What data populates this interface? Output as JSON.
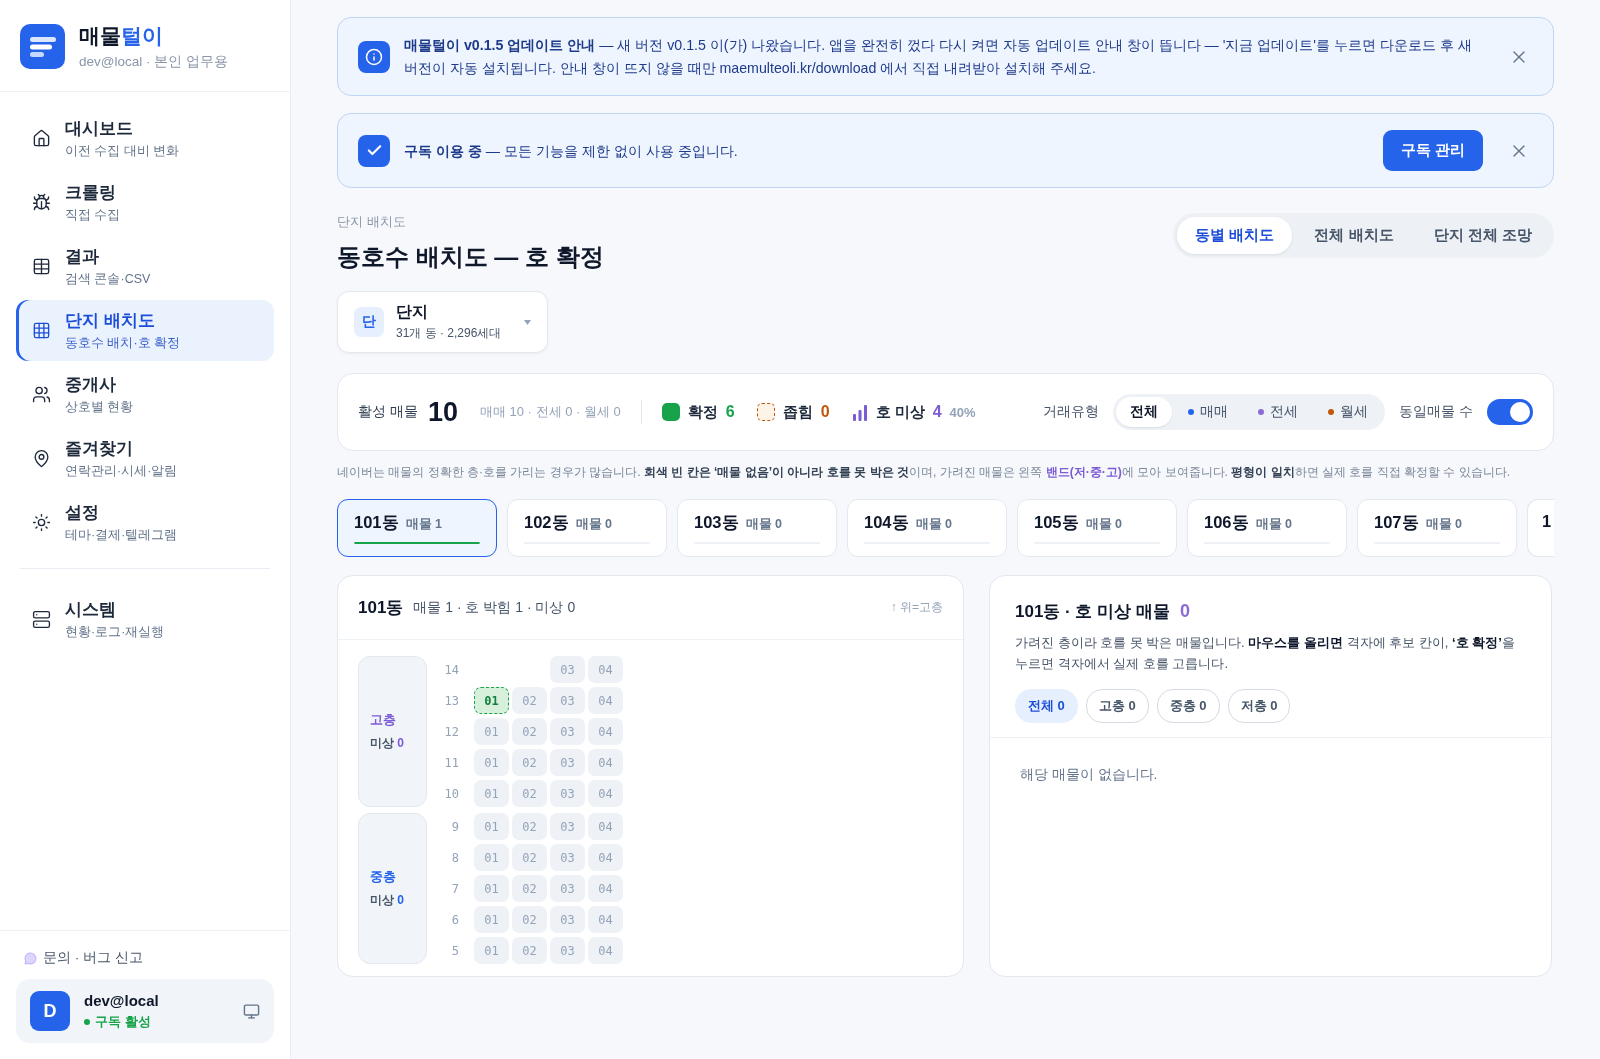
{
  "sidebar": {
    "brand": {
      "title": [
        {
          "text": "매물",
          "accent": false
        },
        {
          "text": "털이",
          "accent": true
        }
      ],
      "subtitle": "dev@local · 본인 업무용"
    },
    "nav_groups": [
      [
        {
          "label": "대시보드",
          "sub": "이전 수집 대비 변화",
          "selected": false
        },
        {
          "label": "크롤링",
          "sub": "직접 수집",
          "selected": false
        },
        {
          "label": "결과",
          "sub": "검색 콘솔·CSV",
          "selected": false
        },
        {
          "label": "단지 배치도",
          "sub": "동호수 배치·호 확정",
          "selected": true
        },
        {
          "label": "중개사",
          "sub": "상호별 현황",
          "selected": false
        },
        {
          "label": "즐겨찾기",
          "sub": "연락관리·시세·알림",
          "selected": false
        },
        {
          "label": "설정",
          "sub": "테마·결제·텔레그램",
          "selected": false
        }
      ],
      [
        {
          "label": "시스템",
          "sub": "현황·로그·재실행",
          "selected": false
        }
      ]
    ],
    "feedback": "문의 · 버그 신고",
    "user": {
      "avatar": "D",
      "name": "dev@local",
      "status": "구독 활성"
    }
  },
  "banners": [
    {
      "kind": "info",
      "text": "**매물털이 v0.1.5 업데이트 안내** — 새 버전 v0.1.5 이(가) 나왔습니다. 앱을 완전히 껐다 다시 켜면 자동 업데이트 안내 창이 뜹니다 — '지금 업데이트'를 누르면 다운로드 후 새 버전이 자동 설치됩니다. 안내 창이 뜨지 않을 때만 maemulteoli.kr/download 에서 직접 내려받아 설치해 주세요."
    },
    {
      "kind": "success",
      "text": "**구독 이용 중** — 모든 기능을 제한 없이 사용 중입니다.",
      "button": "구독 관리"
    }
  ],
  "page": {
    "breadcrumb": "단지 배치도",
    "title": "동호수 배치도 — 호 확정",
    "view_tabs": [
      {
        "label": "동별 배치도",
        "selected": true
      },
      {
        "label": "전체 배치도",
        "selected": false
      },
      {
        "label": "단지 전체 조망",
        "selected": false
      }
    ],
    "complex": {
      "badge": "단",
      "name": "단지",
      "meta": "31개 동 · 2,296세대"
    }
  },
  "stats": {
    "active_label": "활성 매물",
    "active_count": "10",
    "breakdown": "매매 10 · 전세 0 · 월세 0",
    "legend": [
      {
        "kind": "confirmed",
        "label": "확정",
        "count": "6"
      },
      {
        "kind": "narrowed",
        "label": "좁힘",
        "count": "0"
      },
      {
        "kind": "unplaced",
        "label": "호 미상",
        "count": "4",
        "percent": "40%"
      }
    ],
    "trade_label": "거래유형",
    "trade_types": [
      {
        "label": "전체",
        "selected": true
      },
      {
        "label": "매매",
        "selected": false,
        "color": "#2563eb"
      },
      {
        "label": "전세",
        "selected": false,
        "color": "#8b6ad8"
      },
      {
        "label": "월세",
        "selected": false,
        "color": "#c2570c"
      }
    ],
    "same_count": {
      "label": "동일매물 수",
      "on": true
    }
  },
  "notice": "네이버는 매물의 정확한 층·호를 가리는 경우가 많습니다. **회색 빈 칸은 ‘매물 없음’이 아니라 호를 못 박은 것**이며, 가려진 매물은 왼쪽 **밴드(저·중·고)**에 모아 보여줍니다. **평형이 일치**하면 실제 호를 직접 확정할 수 있습니다.",
  "buildings": [
    {
      "name": "101동",
      "count": "매물 1",
      "selected": true,
      "level": 1
    },
    {
      "name": "102동",
      "count": "매물 0",
      "selected": false,
      "level": 0
    },
    {
      "name": "103동",
      "count": "매물 0",
      "selected": false,
      "level": 0
    },
    {
      "name": "104동",
      "count": "매물 0",
      "selected": false,
      "level": 0
    },
    {
      "name": "105동",
      "count": "매물 0",
      "selected": false,
      "level": 0
    },
    {
      "name": "106동",
      "count": "매물 0",
      "selected": false,
      "level": 0
    },
    {
      "name": "107동",
      "count": "매물 0",
      "selected": false,
      "level": 0
    },
    {
      "name": "1",
      "selected": false,
      "kind": "partial"
    }
  ],
  "layout_panel": {
    "title": "101동",
    "summary": "매물 1 · 호 박힘 1 · 미상 0",
    "hint": "↑ 위=고층",
    "bands": [
      {
        "label": "고층",
        "unplaced_label": "미상",
        "count": "0",
        "color": "#7c5cd6",
        "floors": [
          {
            "floor": "14",
            "units": [
              {
                "kind": "gap"
              },
              {
                "kind": "gap"
              },
              {
                "kind": "empty",
                "label": "03"
              },
              {
                "kind": "empty",
                "label": "04"
              }
            ]
          },
          {
            "floor": "13",
            "units": [
              {
                "kind": "confirmed",
                "label": "01"
              },
              {
                "kind": "empty",
                "label": "02"
              },
              {
                "kind": "empty",
                "label": "03"
              },
              {
                "kind": "empty",
                "label": "04"
              }
            ]
          },
          {
            "floor": "12",
            "units": [
              {
                "kind": "empty",
                "label": "01"
              },
              {
                "kind": "empty",
                "label": "02"
              },
              {
                "kind": "empty",
                "label": "03"
              },
              {
                "kind": "empty",
                "label": "04"
              }
            ]
          },
          {
            "floor": "11",
            "units": [
              {
                "kind": "empty",
                "label": "01"
              },
              {
                "kind": "empty",
                "label": "02"
              },
              {
                "kind": "empty",
                "label": "03"
              },
              {
                "kind": "empty",
                "label": "04"
              }
            ]
          },
          {
            "floor": "10",
            "units": [
              {
                "kind": "empty",
                "label": "01"
              },
              {
                "kind": "empty",
                "label": "02"
              },
              {
                "kind": "empty",
                "label": "03"
              },
              {
                "kind": "empty",
                "label": "04"
              }
            ]
          }
        ]
      },
      {
        "label": "중층",
        "unplaced_label": "미상",
        "count": "0",
        "color": "#2563eb",
        "floors": [
          {
            "floor": "9",
            "units": [
              {
                "kind": "empty",
                "label": "01"
              },
              {
                "kind": "empty",
                "label": "02"
              },
              {
                "kind": "empty",
                "label": "03"
              },
              {
                "kind": "empty",
                "label": "04"
              }
            ]
          },
          {
            "floor": "8",
            "units": [
              {
                "kind": "empty",
                "label": "01"
              },
              {
                "kind": "empty",
                "label": "02"
              },
              {
                "kind": "empty",
                "label": "03"
              },
              {
                "kind": "empty",
                "label": "04"
              }
            ]
          },
          {
            "floor": "7",
            "units": [
              {
                "kind": "empty",
                "label": "01"
              },
              {
                "kind": "empty",
                "label": "02"
              },
              {
                "kind": "empty",
                "label": "03"
              },
              {
                "kind": "empty",
                "label": "04"
              }
            ]
          },
          {
            "floor": "6",
            "units": [
              {
                "kind": "empty",
                "label": "01"
              },
              {
                "kind": "empty",
                "label": "02"
              },
              {
                "kind": "empty",
                "label": "03"
              },
              {
                "kind": "empty",
                "label": "04"
              }
            ]
          },
          {
            "floor": "5",
            "units": [
              {
                "kind": "empty",
                "label": "01"
              },
              {
                "kind": "empty",
                "label": "02"
              },
              {
                "kind": "empty",
                "label": "03"
              },
              {
                "kind": "empty",
                "label": "04"
              }
            ]
          }
        ]
      }
    ]
  },
  "unplaced_panel": {
    "title": "101동 · 호 미상 매물",
    "count": "0",
    "description": "가려진 층이라 호를 못 박은 매물입니다. **마우스를 올리면** 격자에 후보 칸이, **‘호 확정’**을 누르면 격자에서 실제 호를 고릅니다.",
    "filters": [
      {
        "label": "전체 0",
        "selected": true
      },
      {
        "label": "고층 0",
        "selected": false
      },
      {
        "label": "중층 0",
        "selected": false
      },
      {
        "label": "저층 0",
        "selected": false
      }
    ],
    "empty": "해당 매물이 없습니다."
  }
}
